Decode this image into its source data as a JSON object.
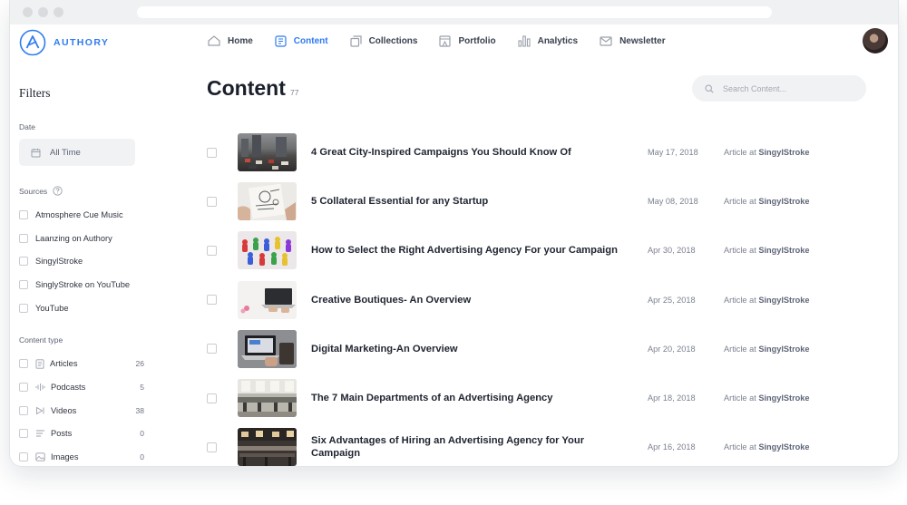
{
  "brand": {
    "name": "AUTHORY",
    "accent": "#2e7bf0"
  },
  "nav": [
    {
      "label": "Home",
      "icon": "home-icon",
      "active": false
    },
    {
      "label": "Content",
      "icon": "content-icon",
      "active": true
    },
    {
      "label": "Collections",
      "icon": "collections-icon",
      "active": false
    },
    {
      "label": "Portfolio",
      "icon": "portfolio-icon",
      "active": false
    },
    {
      "label": "Analytics",
      "icon": "analytics-icon",
      "active": false
    },
    {
      "label": "Newsletter",
      "icon": "newsletter-icon",
      "active": false
    }
  ],
  "sidebar": {
    "title": "Filters",
    "date_label": "Date",
    "date_value": "All Time",
    "sources_label": "Sources",
    "sources": [
      "Atmosphere Cue Music",
      "Laanzing on Authory",
      "SingylStroke",
      "SinglyStroke on YouTube",
      "YouTube"
    ],
    "content_type_label": "Content type",
    "content_types": [
      {
        "label": "Articles",
        "count": "26",
        "icon": "article-icon"
      },
      {
        "label": "Podcasts",
        "count": "5",
        "icon": "podcast-icon"
      },
      {
        "label": "Videos",
        "count": "38",
        "icon": "video-icon"
      },
      {
        "label": "Posts",
        "count": "0",
        "icon": "post-icon"
      },
      {
        "label": "Images",
        "count": "0",
        "icon": "image-icon"
      }
    ]
  },
  "main": {
    "title": "Content",
    "count": "77",
    "search_placeholder": "Search Content...",
    "rows": [
      {
        "title": "4 Great City-Inspired Campaigns You Should Know Of",
        "date": "May 17, 2018",
        "type": "Article at",
        "source": "SingylStroke"
      },
      {
        "title": "5 Collateral Essential for any Startup",
        "date": "May 08, 2018",
        "type": "Article at",
        "source": "SingylStroke"
      },
      {
        "title": "How to Select the Right Advertising Agency For your Campaign",
        "date": "Apr 30, 2018",
        "type": "Article at",
        "source": "SingylStroke"
      },
      {
        "title": "Creative Boutiques- An Overview",
        "date": "Apr 25, 2018",
        "type": "Article at",
        "source": "SingylStroke"
      },
      {
        "title": "Digital Marketing-An Overview",
        "date": "Apr 20, 2018",
        "type": "Article at",
        "source": "SingylStroke"
      },
      {
        "title": "The 7 Main Departments of an Advertising Agency",
        "date": "Apr 18, 2018",
        "type": "Article at",
        "source": "SingylStroke"
      },
      {
        "title": "Six Advantages of Hiring an Advertising Agency for Your Campaign",
        "date": "Apr 16, 2018",
        "type": "Article at",
        "source": "SingylStroke"
      }
    ]
  }
}
